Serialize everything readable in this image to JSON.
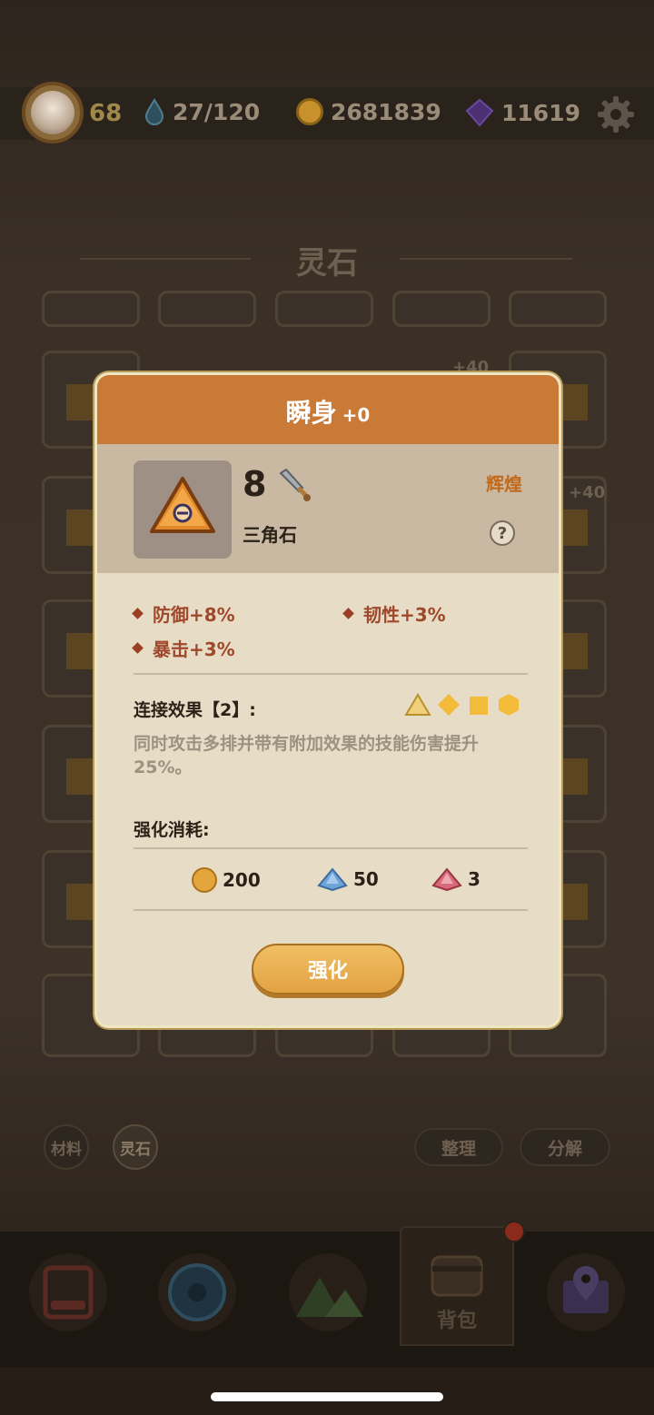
{
  "topbar": {
    "level": "68",
    "stamina": "27/120",
    "coins": "2681839",
    "gems": "11619",
    "icons": [
      "avatar",
      "drop-icon",
      "coin-icon",
      "gem-icon",
      "gear-icon"
    ]
  },
  "page": {
    "title": "灵石"
  },
  "grid": {
    "badge_a": "+40",
    "badge_b": "+40"
  },
  "bottom": {
    "tab_material": "材料",
    "tab_stone": "灵石",
    "sort_button": "整理",
    "decompose_button": "分解",
    "nav_bag_label": "背包"
  },
  "modal": {
    "title": "瞬身",
    "title_plus": "+0",
    "level": "8",
    "stone_name": "三角石",
    "rarity": "辉煌",
    "help": "?",
    "stats": [
      "防御+8%",
      "韧性+3%",
      "暴击+3%"
    ],
    "link_label": "连接效果【2】:",
    "link_desc": "同时攻击多排并带有附加效果的技能伤害提升25%。",
    "cost_label": "强化消耗:",
    "costs": [
      "200",
      "50",
      "3"
    ],
    "enhance_button": "强化",
    "colors": {
      "header": "#c87a36",
      "accent": "#c26a1c",
      "stat": "#a0482c",
      "button": "#e9b253"
    }
  }
}
